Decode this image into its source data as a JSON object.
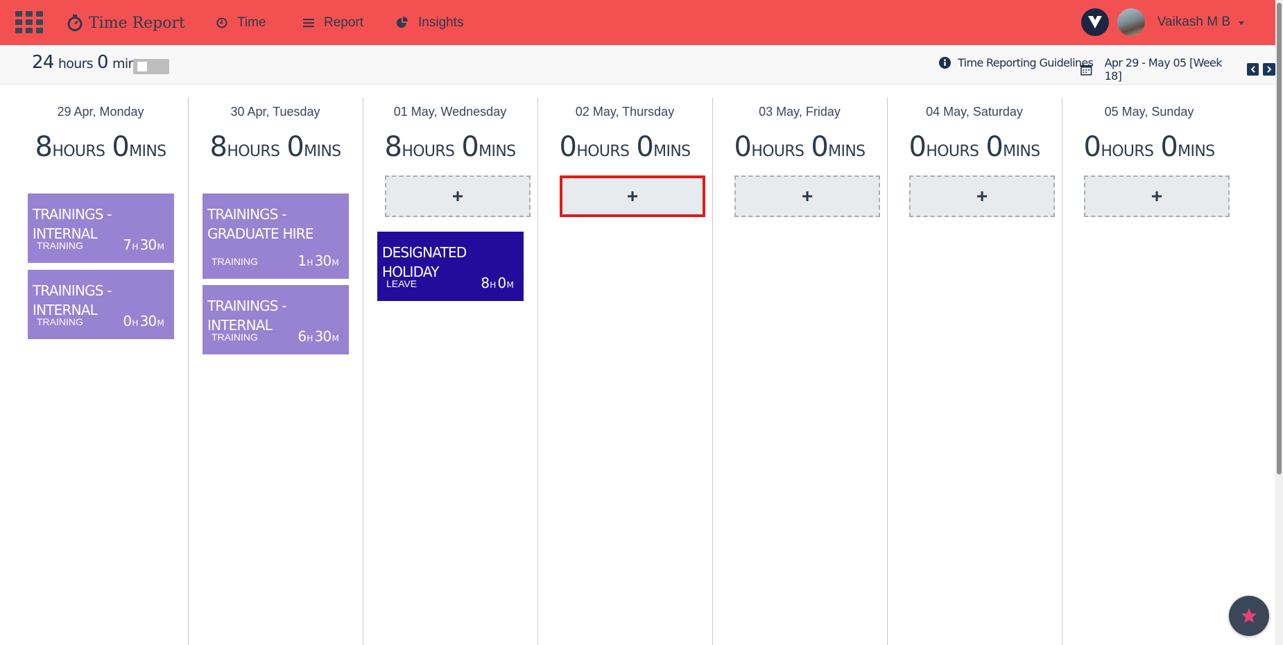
{
  "header": {
    "app_title": "Time Report",
    "nav": [
      {
        "label": "Time",
        "icon": "clock-icon"
      },
      {
        "label": "Report",
        "icon": "list-icon"
      },
      {
        "label": "Insights",
        "icon": "pie-chart-icon"
      }
    ],
    "user_name": "Vaikash M B",
    "brand_color": "#f35151"
  },
  "summary": {
    "hours": "24",
    "hours_unit": "hours",
    "mins": "0",
    "mins_unit": "mins",
    "guidelines_label": "Time Reporting Guidelines",
    "week_range": "Apr 29 - May 05 [Week 18]"
  },
  "days": [
    {
      "title": "29 Apr, Monday",
      "hours": "8",
      "mins": "0",
      "entries": [
        {
          "title": "TRAININGS - INTERNAL",
          "type": "TRAINING",
          "h": "7",
          "m": "30"
        },
        {
          "title": "TRAININGS - INTERNAL",
          "type": "TRAINING",
          "h": "0",
          "m": "30"
        }
      ]
    },
    {
      "title": "30 Apr, Tuesday",
      "hours": "8",
      "mins": "0",
      "entries": [
        {
          "title": "TRAININGS - GRADUATE HIRE",
          "type": "TRAINING",
          "h": "1",
          "m": "30"
        },
        {
          "title": "TRAININGS - INTERNAL",
          "type": "TRAINING",
          "h": "6",
          "m": "30"
        }
      ]
    },
    {
      "title": "01 May, Wednesday",
      "hours": "8",
      "mins": "0",
      "entries": [
        {
          "title": "DESIGNATED HOLIDAY",
          "type": "LEAVE",
          "h": "8",
          "m": "0"
        }
      ]
    },
    {
      "title": "02 May, Thursday",
      "hours": "0",
      "mins": "0",
      "entries": []
    },
    {
      "title": "03 May, Friday",
      "hours": "0",
      "mins": "0",
      "entries": []
    },
    {
      "title": "04 May, Saturday",
      "hours": "0",
      "mins": "0",
      "entries": []
    },
    {
      "title": "05 May, Sunday",
      "hours": "0",
      "mins": "0",
      "entries": []
    }
  ],
  "labels": {
    "hours_unit": "HOURS",
    "mins_unit": "MINS",
    "h_suffix": "H",
    "m_suffix": "M",
    "add_symbol": "+"
  }
}
